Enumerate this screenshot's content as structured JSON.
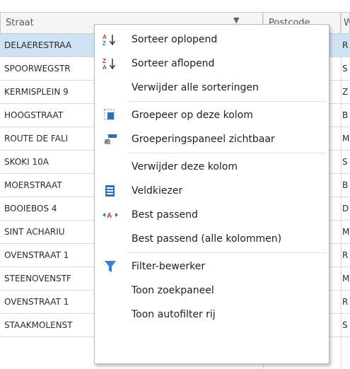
{
  "grid": {
    "columns": [
      {
        "label": "Straat"
      },
      {
        "label": "Postcode"
      },
      {
        "label": "W"
      }
    ],
    "rows": [
      {
        "straat": "DELAERESTRAA",
        "postcode": "",
        "w": "R",
        "selected": true
      },
      {
        "straat": "SPOORWEGSTR",
        "postcode": "",
        "w": "S",
        "selected": false
      },
      {
        "straat": "KERMISPLEIN 9",
        "postcode": "",
        "w": "Z",
        "selected": false
      },
      {
        "straat": "HOOGSTRAAT",
        "postcode": "",
        "w": "B",
        "selected": false
      },
      {
        "straat": "ROUTE DE FALI",
        "postcode": "",
        "w": "M",
        "selected": false
      },
      {
        "straat": "SKOKI  10A",
        "postcode": "",
        "w": "S",
        "selected": false
      },
      {
        "straat": "MOERSTRAAT",
        "postcode": "",
        "w": "B",
        "selected": false
      },
      {
        "straat": "BOOIEBOS 4",
        "postcode": "",
        "w": "D",
        "selected": false
      },
      {
        "straat": "SINT ACHARIU",
        "postcode": "",
        "w": "M",
        "selected": false
      },
      {
        "straat": "OVENSTRAAT 1",
        "postcode": "",
        "w": "R",
        "selected": false
      },
      {
        "straat": "STEENOVENSTF",
        "postcode": "",
        "w": "M",
        "selected": false
      },
      {
        "straat": "OVENSTRAAT 1",
        "postcode": "",
        "w": "R",
        "selected": false
      },
      {
        "straat": "STAAKMOLENST",
        "postcode": "",
        "w": "S",
        "selected": false
      }
    ]
  },
  "context_menu": {
    "items": [
      {
        "label": "Sorteer oplopend",
        "icon": "sort-ascending-icon"
      },
      {
        "label": "Sorteer aflopend",
        "icon": "sort-descending-icon"
      },
      {
        "label": "Verwijder alle sorteringen",
        "icon": ""
      },
      {
        "label": "Groepeer op deze kolom",
        "icon": "group-by-column-icon"
      },
      {
        "label": "Groeperingspaneel zichtbaar",
        "icon": "group-panel-icon"
      },
      {
        "label": "Verwijder deze kolom",
        "icon": ""
      },
      {
        "label": "Veldkiezer",
        "icon": "field-chooser-icon"
      },
      {
        "label": "Best passend",
        "icon": "best-fit-icon"
      },
      {
        "label": "Best passend (alle kolommen)",
        "icon": ""
      },
      {
        "label": "Filter-bewerker",
        "icon": "filter-icon"
      },
      {
        "label": "Toon zoekpaneel",
        "icon": ""
      },
      {
        "label": "Toon autofilter rij",
        "icon": ""
      }
    ],
    "separators_after": [
      2,
      4,
      8
    ],
    "accent_color": "#3b82d6"
  }
}
